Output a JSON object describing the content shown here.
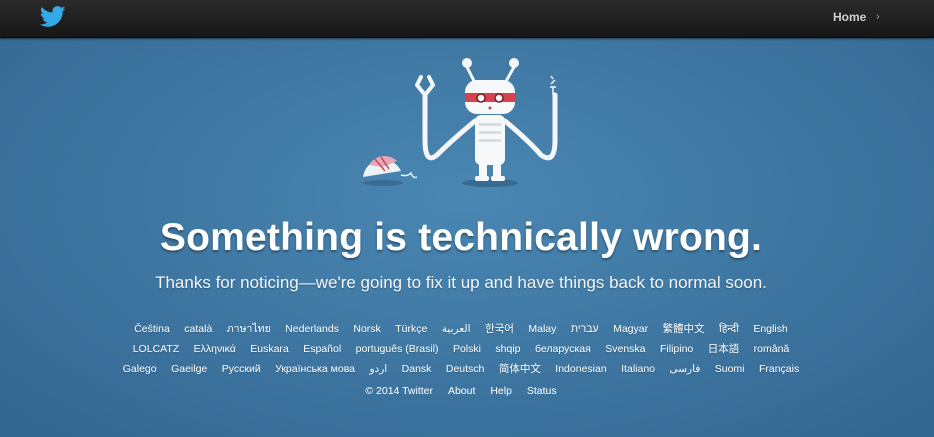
{
  "topbar": {
    "home_label": "Home",
    "home_chevron": "›",
    "logo_icon": "twitter-bird-icon"
  },
  "error": {
    "headline": "Something is technically wrong.",
    "message": "Thanks for noticing—we're going to fix it up and have things back to normal soon."
  },
  "languages": [
    [
      "Čeština",
      "català",
      "ภาษาไทย",
      "Nederlands",
      "Norsk",
      "Türkçe",
      "العربية",
      "한국어",
      "Malay",
      "עברית",
      "Magyar",
      "繁體中文",
      "हिन्दी",
      "English"
    ],
    [
      "LOLCATZ",
      "Ελληνικά",
      "Euskara",
      "Español",
      "português (Brasil)",
      "Polski",
      "shqip",
      "беларуская",
      "Svenska",
      "Filipino",
      "日本語",
      "română"
    ],
    [
      "Galego",
      "Gaeilge",
      "Русский",
      "Українська мова",
      "اردو",
      "Dansk",
      "Deutsch",
      "简体中文",
      "Indonesian",
      "Italiano",
      "فارسی",
      "Suomi",
      "Français"
    ]
  ],
  "footer": {
    "copyright": "© 2014 Twitter",
    "about": "About",
    "help": "Help",
    "status": "Status"
  }
}
